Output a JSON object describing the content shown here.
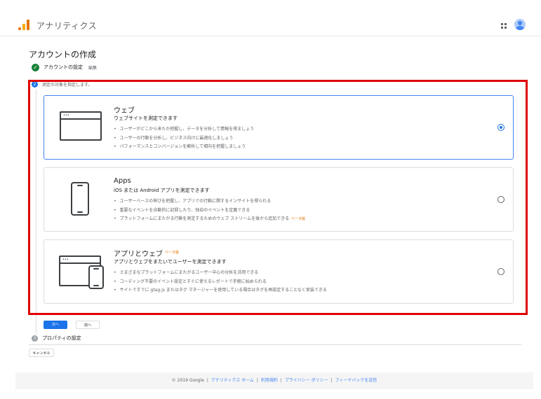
{
  "header": {
    "app_title": "アナリティクス",
    "apps_icon": "apps-grid-icon",
    "avatar_icon": "account-avatar-icon"
  },
  "page": {
    "title": "アカウントの作成"
  },
  "steps": {
    "account": {
      "label": "アカウントの設定",
      "edit": "編集"
    },
    "measure": {
      "number": "2",
      "label": "測定の対象を指定します。"
    },
    "property": {
      "number": "3",
      "label": "プロパティの設定"
    }
  },
  "options": [
    {
      "title": "ウェブ",
      "subtitle": "ウェブサイトを測定できます",
      "bullets": [
        "ユーザーがどこから来たか把握し、データを分析して情報を得ましょう",
        "ユーザーの行動を分析し、ビジネス向けに最適化しましょう",
        "パフォーマンスとコンバージョンを解析して傾向を把握しましょう"
      ],
      "selected": true,
      "icon": "browser-window-icon"
    },
    {
      "title": "Apps",
      "subtitle": "iOS または Android アプリを測定できます",
      "bullets": [
        "ユーザーベースの伸びを把握し、アプリでの行動に関するインサイトを得られる",
        "重要なイベントを自動的に記録したり、独自のイベントを定義できる",
        "プラットフォームにまたがる行動を測定するためのウェブ ストリームを後から追加できる"
      ],
      "bullet3_badge": "ベータ版",
      "selected": false,
      "icon": "smartphone-icon"
    },
    {
      "title": "アプリとウェブ",
      "title_badge": "ベータ版",
      "subtitle": "アプリとウェブをまたいでユーザーを測定できます",
      "bullets": [
        "さまざまなプラットフォームにまたがるユーザー中心の分析を活用できる",
        "コーディング不要のイベント設定とすぐに使えるレポートで手軽に始められる",
        "サイトですでに gtag.js またはタグ マネージャーを使用している場合はタグを再設定することなく実装できる"
      ],
      "selected": false,
      "icon": "browser-and-phone-icon"
    }
  ],
  "buttons": {
    "next": "次へ",
    "prev": "前へ",
    "cancel": "キャンセル"
  },
  "footer": {
    "copyright": "© 2019 Google",
    "links": [
      "アナリティクス ホーム",
      "利用規約",
      "プライバシー ポリシー",
      "フィードバックを送信"
    ]
  },
  "colors": {
    "accent": "#1a73e8",
    "highlight_border": "#e00000",
    "success": "#188038",
    "beta": "#e37400"
  }
}
